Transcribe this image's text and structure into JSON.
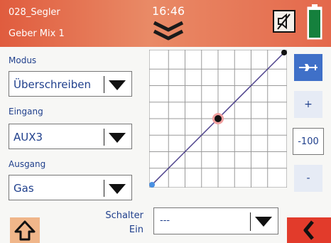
{
  "header": {
    "model_name": "028_Segler",
    "page_name": "Geber Mix 1",
    "clock": "16:46"
  },
  "modus": {
    "label": "Modus",
    "value": "Überschreiben"
  },
  "eingang": {
    "label": "Eingang",
    "value": "AUX3"
  },
  "ausgang": {
    "label": "Ausgang",
    "value": "Gas"
  },
  "curve": {
    "points": [
      {
        "input": -100,
        "output": -100
      },
      {
        "input": 0,
        "output": 0
      },
      {
        "input": 100,
        "output": 100
      }
    ],
    "selected_point": 0
  },
  "side": {
    "plus": "+",
    "value": "-100",
    "minus": "-"
  },
  "schalter": {
    "label_line1": "Schalter",
    "label_line2": "Ein",
    "value": "---"
  },
  "colors": {
    "header": "#e4684b",
    "text": "#1f3f8c",
    "accent": "#3f70c8",
    "back": "#e23b2b",
    "home": "#f0b68a",
    "start_point": "#4a90e2"
  }
}
